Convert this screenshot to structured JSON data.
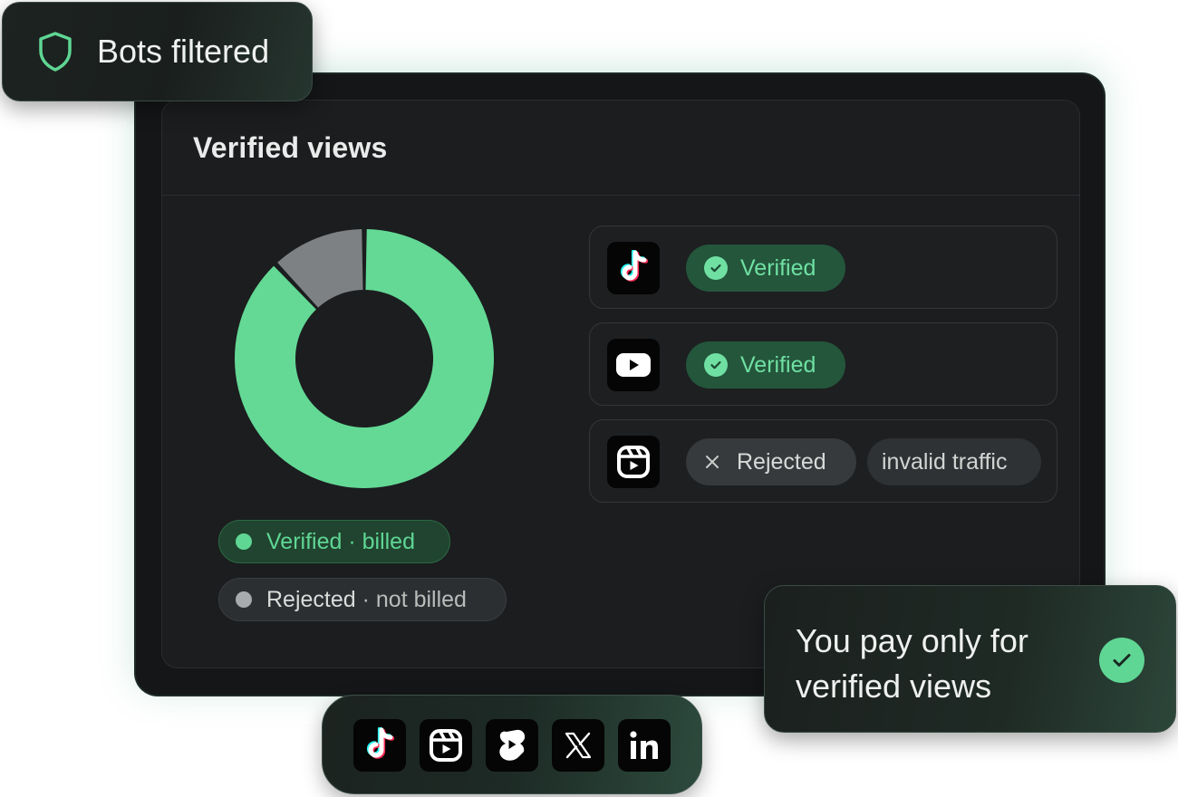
{
  "floating_badge": {
    "label": "Bots filtered",
    "icon": "shield-icon"
  },
  "card": {
    "title": "Verified views"
  },
  "chart_data": {
    "type": "pie",
    "style": "donut",
    "slices": [
      {
        "label": "Verified · billed",
        "value": 88,
        "color": "#63d995"
      },
      {
        "label": "Rejected · not billed",
        "value": 12,
        "color": "#7d8183"
      }
    ]
  },
  "legend": {
    "verified": {
      "main": "Verified",
      "sub": " · billed",
      "color": "#5fd694"
    },
    "rejected": {
      "main": "Rejected",
      "sub": " · not billed",
      "color": "#a8abad"
    }
  },
  "platform_rows": [
    {
      "icon": "tiktok-icon",
      "status": "Verified"
    },
    {
      "icon": "youtube-icon",
      "status": "Verified"
    },
    {
      "icon": "instagram-reels-icon",
      "status": "Rejected",
      "reason": "invalid traffic"
    }
  ],
  "pay_card": {
    "text": "You pay only for verified views",
    "icon": "check-icon"
  },
  "platform_strip": [
    {
      "icon": "tiktok-icon"
    },
    {
      "icon": "instagram-reels-icon"
    },
    {
      "icon": "youtube-shorts-icon"
    },
    {
      "icon": "x-icon"
    },
    {
      "icon": "linkedin-icon"
    }
  ],
  "colors": {
    "accent_green": "#5fd694",
    "panel_bg": "#141617",
    "card_bg": "#1b1d1f",
    "rejected_gray": "#7d8183"
  }
}
